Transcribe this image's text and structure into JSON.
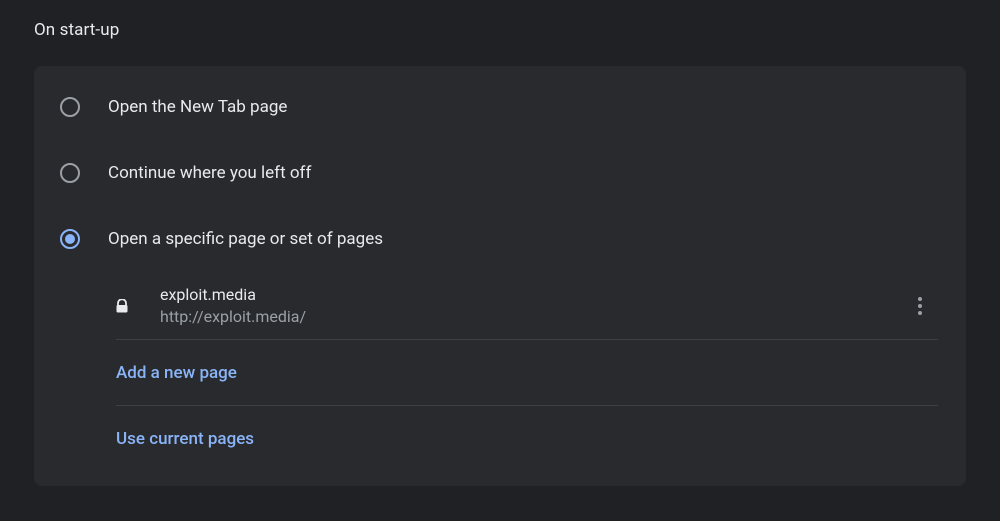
{
  "section_title": "On start-up",
  "radios": {
    "new_tab": {
      "label": "Open the New Tab page",
      "checked": false
    },
    "continue": {
      "label": "Continue where you left off",
      "checked": false
    },
    "specific": {
      "label": "Open a specific page or set of pages",
      "checked": true
    }
  },
  "startup_page": {
    "title": "exploit.media",
    "url": "http://exploit.media/"
  },
  "actions": {
    "add_page": "Add a new page",
    "use_current": "Use current pages"
  }
}
